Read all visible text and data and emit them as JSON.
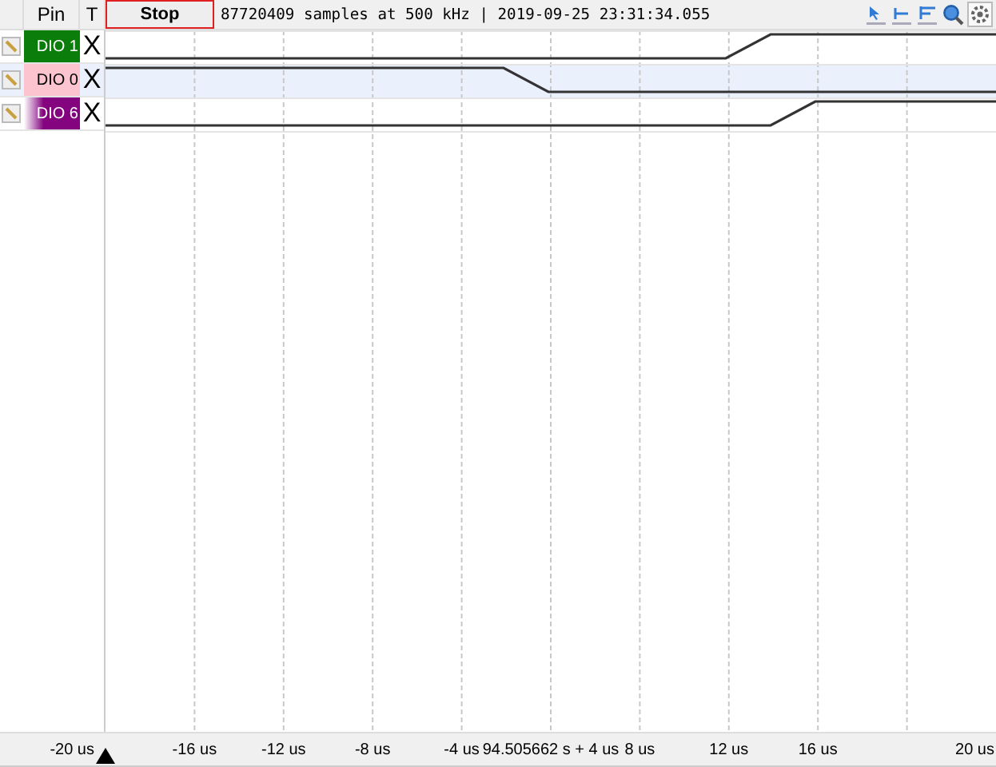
{
  "header": {
    "pin_column": "Pin",
    "trigger_column": "T",
    "stop_button": "Stop",
    "status": "87720409 samples at 500 kHz | 2019-09-25 23:31:34.055"
  },
  "channels": [
    {
      "name": "DIO 1",
      "color": "#0b7d0b",
      "trigger": "X",
      "selected": false
    },
    {
      "name": "DIO 0",
      "color": "#fbc4cf",
      "trigger": "X",
      "selected": true
    },
    {
      "name": "DIO 6",
      "color": "#84047f",
      "trigger": "X",
      "selected": false
    }
  ],
  "axis": {
    "labels": [
      "-20 us",
      "-16 us",
      "-12 us",
      "-8 us",
      "-4 us",
      "94.505662 s + 4 us",
      "8 us",
      "12 us",
      "16 us",
      "20 us"
    ]
  }
}
